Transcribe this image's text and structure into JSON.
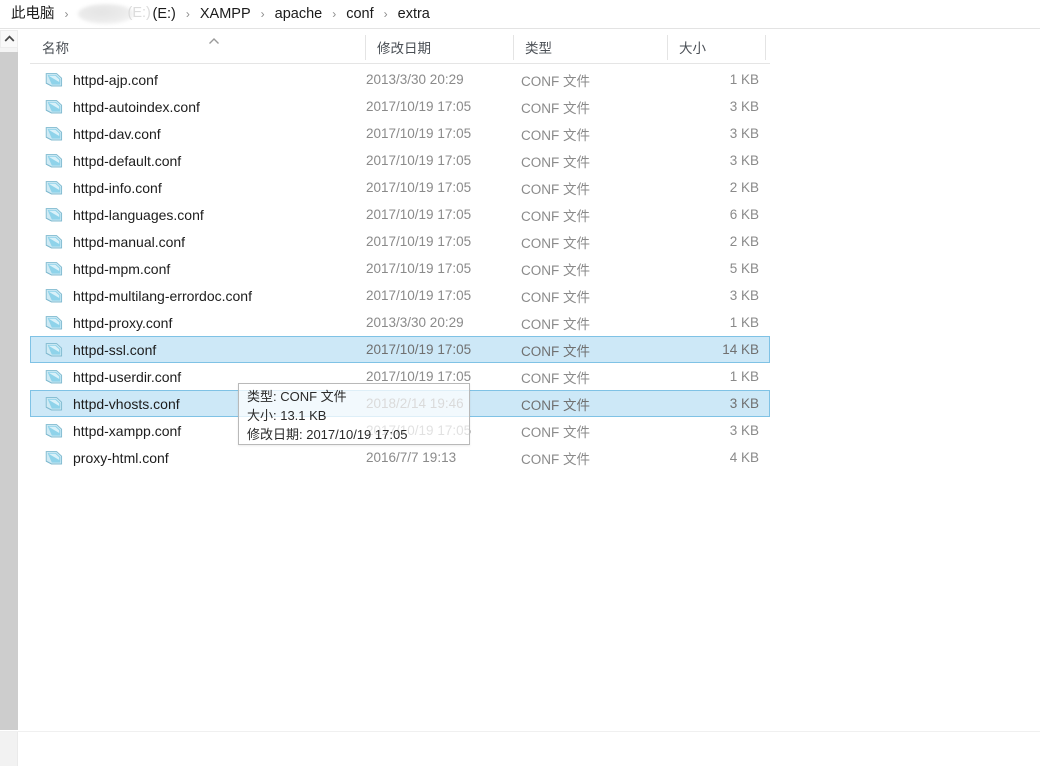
{
  "breadcrumb": {
    "items": [
      {
        "label": "此电脑",
        "type": "text"
      },
      {
        "label": "",
        "type": "redacted",
        "suffix": "(E:)"
      },
      {
        "label": "XAMPP",
        "type": "text"
      },
      {
        "label": "apache",
        "type": "text"
      },
      {
        "label": "conf",
        "type": "text"
      },
      {
        "label": "extra",
        "type": "text"
      }
    ],
    "separator": "›"
  },
  "columns": {
    "name": "名称",
    "date_modified": "修改日期",
    "type": "类型",
    "size": "大小",
    "sort_indicator": "ascending-caret-icon"
  },
  "files": [
    {
      "name": "httpd-ajp.conf",
      "date": "2013/3/30 20:29",
      "type": "CONF 文件",
      "size": "1 KB",
      "selected": false
    },
    {
      "name": "httpd-autoindex.conf",
      "date": "2017/10/19 17:05",
      "type": "CONF 文件",
      "size": "3 KB",
      "selected": false
    },
    {
      "name": "httpd-dav.conf",
      "date": "2017/10/19 17:05",
      "type": "CONF 文件",
      "size": "3 KB",
      "selected": false
    },
    {
      "name": "httpd-default.conf",
      "date": "2017/10/19 17:05",
      "type": "CONF 文件",
      "size": "3 KB",
      "selected": false
    },
    {
      "name": "httpd-info.conf",
      "date": "2017/10/19 17:05",
      "type": "CONF 文件",
      "size": "2 KB",
      "selected": false
    },
    {
      "name": "httpd-languages.conf",
      "date": "2017/10/19 17:05",
      "type": "CONF 文件",
      "size": "6 KB",
      "selected": false
    },
    {
      "name": "httpd-manual.conf",
      "date": "2017/10/19 17:05",
      "type": "CONF 文件",
      "size": "2 KB",
      "selected": false
    },
    {
      "name": "httpd-mpm.conf",
      "date": "2017/10/19 17:05",
      "type": "CONF 文件",
      "size": "5 KB",
      "selected": false
    },
    {
      "name": "httpd-multilang-errordoc.conf",
      "date": "2017/10/19 17:05",
      "type": "CONF 文件",
      "size": "3 KB",
      "selected": false
    },
    {
      "name": "httpd-proxy.conf",
      "date": "2013/3/30 20:29",
      "type": "CONF 文件",
      "size": "1 KB",
      "selected": false
    },
    {
      "name": "httpd-ssl.conf",
      "date": "2017/10/19 17:05",
      "type": "CONF 文件",
      "size": "14 KB",
      "selected": true
    },
    {
      "name": "httpd-userdir.conf",
      "date": "2017/10/19 17:05",
      "type": "CONF 文件",
      "size": "1 KB",
      "selected": false
    },
    {
      "name": "httpd-vhosts.conf",
      "date": "2018/2/14 19:46",
      "type": "CONF 文件",
      "size": "3 KB",
      "selected": true
    },
    {
      "name": "httpd-xampp.conf",
      "date": "2017/10/19 17:05",
      "type": "CONF 文件",
      "size": "3 KB",
      "selected": false
    },
    {
      "name": "proxy-html.conf",
      "date": "2016/7/7 19:13",
      "type": "CONF 文件",
      "size": "4 KB",
      "selected": false
    }
  ],
  "tooltip": {
    "lines": [
      "类型: CONF 文件",
      "大小: 13.1 KB",
      "修改日期: 2017/10/19 17:05"
    ]
  },
  "scrollbar": {
    "up_arrow": "chevron-up-icon"
  },
  "colors": {
    "selection_fill": "#cde8f7",
    "selection_border": "#7fc2e5",
    "file_icon": "#8fd3ea",
    "secondary_text": "#8a8a8a",
    "primary_text": "#1c1c1c"
  }
}
